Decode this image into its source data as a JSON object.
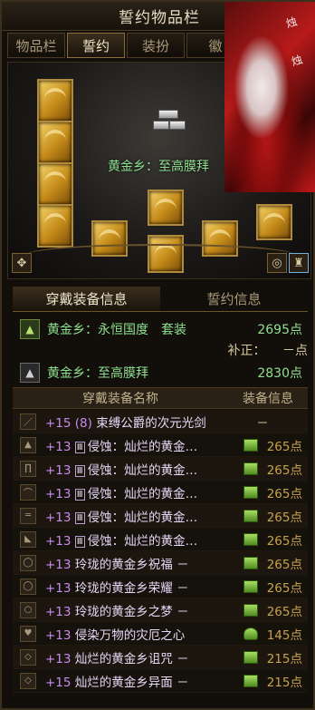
{
  "window": {
    "title": "誓约物品栏"
  },
  "tabs": [
    {
      "label": "物品栏"
    },
    {
      "label": "誓约"
    },
    {
      "label": "装扮"
    },
    {
      "label": "徽"
    }
  ],
  "stage": {
    "set_name": "黄金乡：至高膜拜"
  },
  "photo": {
    "watermark_1": "烛",
    "watermark_2": "烛"
  },
  "info_tabs": [
    {
      "label": "穿戴装备信息"
    },
    {
      "label": "誓约信息"
    }
  ],
  "set_primary": {
    "title": "黄金乡：永恒国度",
    "type": "套装",
    "points": "2695点"
  },
  "bonus": {
    "label": "补正：",
    "value": "－点"
  },
  "set_secondary": {
    "title": "黄金乡：至高膜拜",
    "points": "2830点"
  },
  "table": {
    "col_name": "穿戴装备名称",
    "col_info": "装备信息"
  },
  "equipment": [
    {
      "enh": "+15",
      "lv": "(8)",
      "name": "束缚公爵的次元光剑",
      "info": "－",
      "tag": "",
      "icon": "sword-icon",
      "status": "none"
    },
    {
      "enh": "+13",
      "tag": "Ⅲ",
      "name": "侵蚀：灿烂的黄金…",
      "info": "265点",
      "icon": "coat-icon",
      "status": "gem"
    },
    {
      "enh": "+13",
      "tag": "Ⅲ",
      "name": "侵蚀：灿烂的黄金…",
      "info": "265点",
      "icon": "pants-icon",
      "status": "gem"
    },
    {
      "enh": "+13",
      "tag": "Ⅲ",
      "name": "侵蚀：灿烂的黄金…",
      "info": "265点",
      "icon": "shoulder-icon",
      "status": "gem"
    },
    {
      "enh": "+13",
      "tag": "Ⅲ",
      "name": "侵蚀：灿烂的黄金…",
      "info": "265点",
      "icon": "belt-icon",
      "status": "gem"
    },
    {
      "enh": "+13",
      "tag": "Ⅲ",
      "name": "侵蚀：灿烂的黄金…",
      "info": "265点",
      "icon": "shoes-icon",
      "status": "gem"
    },
    {
      "enh": "+13",
      "tag": "",
      "name": "玲珑的黄金乡祝福 －",
      "info": "265点",
      "icon": "necklace-icon",
      "status": "gem"
    },
    {
      "enh": "+13",
      "tag": "",
      "name": "玲珑的黄金乡荣耀 －",
      "info": "265点",
      "icon": "bracelet-icon",
      "status": "gem"
    },
    {
      "enh": "+13",
      "tag": "",
      "name": "玲珑的黄金乡之梦 －",
      "info": "265点",
      "icon": "ring-icon",
      "status": "gem"
    },
    {
      "enh": "+13",
      "tag": "",
      "name": "侵染万物的灾厄之心",
      "info": "145点",
      "icon": "heart-icon",
      "status": "heart"
    },
    {
      "enh": "+13",
      "tag": "",
      "name": "灿烂的黄金乡诅咒 －",
      "info": "215点",
      "icon": "stone-icon",
      "status": "gem"
    },
    {
      "enh": "+15",
      "tag": "",
      "name": "灿烂的黄金乡异面 －",
      "info": "215点",
      "icon": "earring-icon",
      "status": "gem"
    }
  ]
}
